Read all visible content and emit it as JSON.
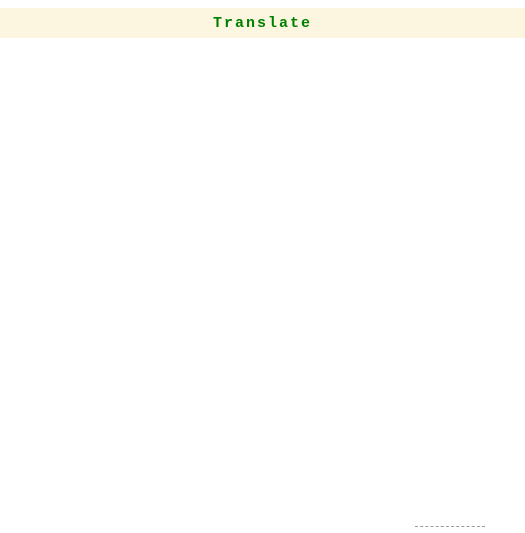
{
  "heading": {
    "title": "Translate"
  }
}
